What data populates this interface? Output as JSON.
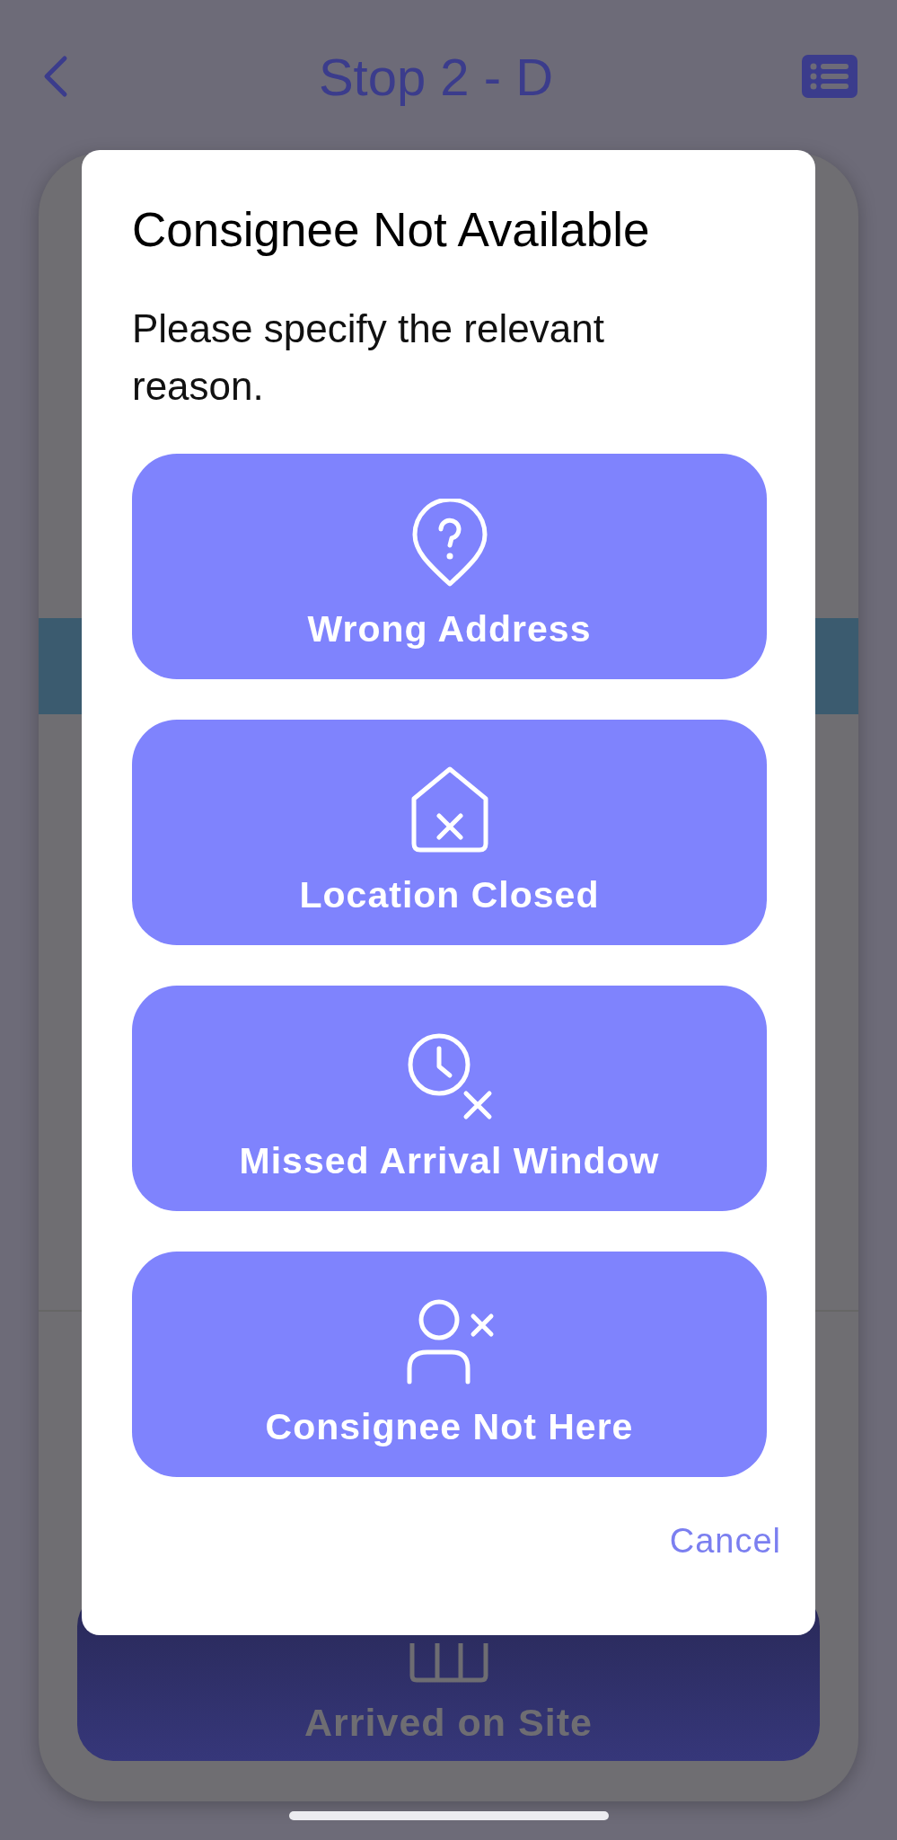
{
  "header": {
    "title": "Stop 2 - D"
  },
  "background_card": {
    "action": {
      "label": "Arrived on Site"
    }
  },
  "dialog": {
    "title": "Consignee Not Available",
    "message": "Please specify the relevant reason.",
    "reasons": [
      {
        "kind": "pin",
        "label": "Wrong Address"
      },
      {
        "kind": "house",
        "label": "Location Closed"
      },
      {
        "kind": "clock",
        "label": "Missed Arrival Window"
      },
      {
        "kind": "person",
        "label": "Consignee Not Here"
      }
    ],
    "cancel": "Cancel"
  }
}
